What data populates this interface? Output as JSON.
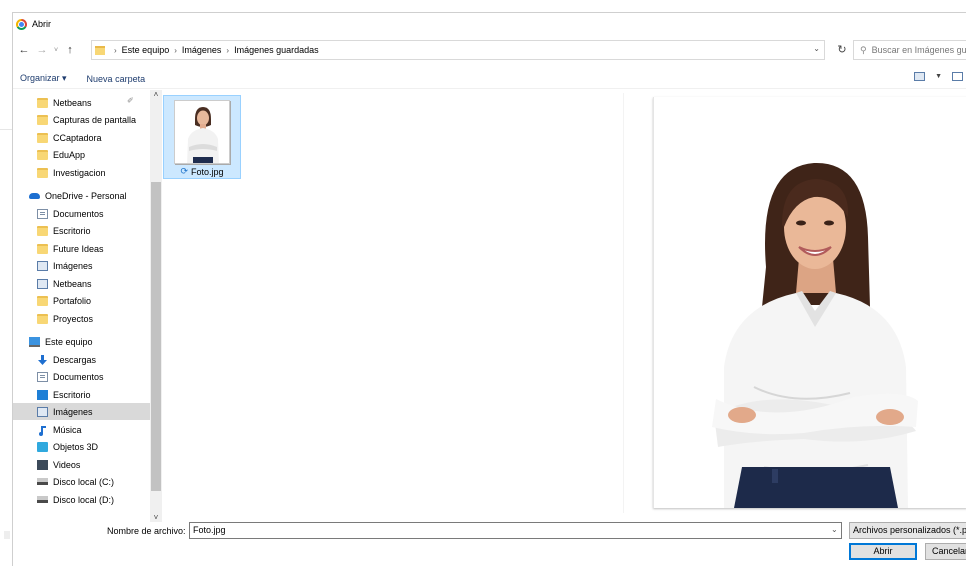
{
  "window": {
    "title": "Abrir"
  },
  "nav": {
    "back": "←",
    "forward": "→",
    "recent": "˅",
    "up": "↑",
    "breadcrumb": [
      "Este equipo",
      "Imágenes",
      "Imágenes guardadas"
    ],
    "search_placeholder": "Buscar en Imágenes guardadas"
  },
  "toolbar": {
    "organize": "Organizar ▾",
    "new_folder": "Nueva carpeta"
  },
  "sidebar": {
    "quick_access": [
      "Netbeans",
      "Capturas de pantalla",
      "CCaptadora",
      "EduApp",
      "Investigacion"
    ],
    "onedrive": "OneDrive - Personal",
    "onedrive_items": [
      "Documentos",
      "Escritorio",
      "Future Ideas",
      "Imágenes",
      "Netbeans",
      "Portafolio",
      "Proyectos"
    ],
    "this_pc": "Este equipo",
    "pc_items": [
      "Descargas",
      "Documentos",
      "Escritorio",
      "Imágenes",
      "Música",
      "Objetos 3D",
      "Videos",
      "Disco local (C:)",
      "Disco local (D:)"
    ]
  },
  "files": [
    {
      "name": "Foto.jpg"
    }
  ],
  "footer": {
    "filename_label": "Nombre de archivo:",
    "filename_value": "Foto.jpg",
    "filetype": "Archivos personalizados (*.png;*.jpg)",
    "open": "Abrir",
    "cancel": "Cancelar"
  }
}
